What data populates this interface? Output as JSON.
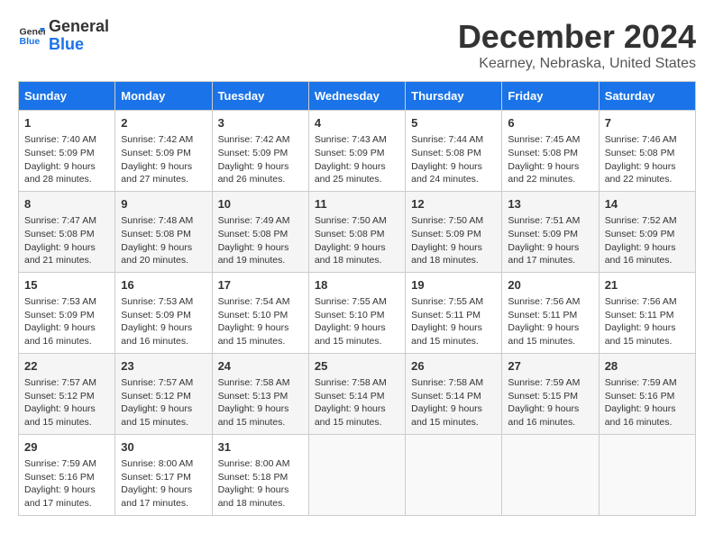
{
  "header": {
    "logo_line1": "General",
    "logo_line2": "Blue",
    "month": "December 2024",
    "location": "Kearney, Nebraska, United States"
  },
  "days_of_week": [
    "Sunday",
    "Monday",
    "Tuesday",
    "Wednesday",
    "Thursday",
    "Friday",
    "Saturday"
  ],
  "weeks": [
    [
      {
        "day": "1",
        "sunrise": "Sunrise: 7:40 AM",
        "sunset": "Sunset: 5:09 PM",
        "daylight": "Daylight: 9 hours and 28 minutes."
      },
      {
        "day": "2",
        "sunrise": "Sunrise: 7:42 AM",
        "sunset": "Sunset: 5:09 PM",
        "daylight": "Daylight: 9 hours and 27 minutes."
      },
      {
        "day": "3",
        "sunrise": "Sunrise: 7:42 AM",
        "sunset": "Sunset: 5:09 PM",
        "daylight": "Daylight: 9 hours and 26 minutes."
      },
      {
        "day": "4",
        "sunrise": "Sunrise: 7:43 AM",
        "sunset": "Sunset: 5:09 PM",
        "daylight": "Daylight: 9 hours and 25 minutes."
      },
      {
        "day": "5",
        "sunrise": "Sunrise: 7:44 AM",
        "sunset": "Sunset: 5:08 PM",
        "daylight": "Daylight: 9 hours and 24 minutes."
      },
      {
        "day": "6",
        "sunrise": "Sunrise: 7:45 AM",
        "sunset": "Sunset: 5:08 PM",
        "daylight": "Daylight: 9 hours and 22 minutes."
      },
      {
        "day": "7",
        "sunrise": "Sunrise: 7:46 AM",
        "sunset": "Sunset: 5:08 PM",
        "daylight": "Daylight: 9 hours and 22 minutes."
      }
    ],
    [
      {
        "day": "8",
        "sunrise": "Sunrise: 7:47 AM",
        "sunset": "Sunset: 5:08 PM",
        "daylight": "Daylight: 9 hours and 21 minutes."
      },
      {
        "day": "9",
        "sunrise": "Sunrise: 7:48 AM",
        "sunset": "Sunset: 5:08 PM",
        "daylight": "Daylight: 9 hours and 20 minutes."
      },
      {
        "day": "10",
        "sunrise": "Sunrise: 7:49 AM",
        "sunset": "Sunset: 5:08 PM",
        "daylight": "Daylight: 9 hours and 19 minutes."
      },
      {
        "day": "11",
        "sunrise": "Sunrise: 7:50 AM",
        "sunset": "Sunset: 5:08 PM",
        "daylight": "Daylight: 9 hours and 18 minutes."
      },
      {
        "day": "12",
        "sunrise": "Sunrise: 7:50 AM",
        "sunset": "Sunset: 5:09 PM",
        "daylight": "Daylight: 9 hours and 18 minutes."
      },
      {
        "day": "13",
        "sunrise": "Sunrise: 7:51 AM",
        "sunset": "Sunset: 5:09 PM",
        "daylight": "Daylight: 9 hours and 17 minutes."
      },
      {
        "day": "14",
        "sunrise": "Sunrise: 7:52 AM",
        "sunset": "Sunset: 5:09 PM",
        "daylight": "Daylight: 9 hours and 16 minutes."
      }
    ],
    [
      {
        "day": "15",
        "sunrise": "Sunrise: 7:53 AM",
        "sunset": "Sunset: 5:09 PM",
        "daylight": "Daylight: 9 hours and 16 minutes."
      },
      {
        "day": "16",
        "sunrise": "Sunrise: 7:53 AM",
        "sunset": "Sunset: 5:09 PM",
        "daylight": "Daylight: 9 hours and 16 minutes."
      },
      {
        "day": "17",
        "sunrise": "Sunrise: 7:54 AM",
        "sunset": "Sunset: 5:10 PM",
        "daylight": "Daylight: 9 hours and 15 minutes."
      },
      {
        "day": "18",
        "sunrise": "Sunrise: 7:55 AM",
        "sunset": "Sunset: 5:10 PM",
        "daylight": "Daylight: 9 hours and 15 minutes."
      },
      {
        "day": "19",
        "sunrise": "Sunrise: 7:55 AM",
        "sunset": "Sunset: 5:11 PM",
        "daylight": "Daylight: 9 hours and 15 minutes."
      },
      {
        "day": "20",
        "sunrise": "Sunrise: 7:56 AM",
        "sunset": "Sunset: 5:11 PM",
        "daylight": "Daylight: 9 hours and 15 minutes."
      },
      {
        "day": "21",
        "sunrise": "Sunrise: 7:56 AM",
        "sunset": "Sunset: 5:11 PM",
        "daylight": "Daylight: 9 hours and 15 minutes."
      }
    ],
    [
      {
        "day": "22",
        "sunrise": "Sunrise: 7:57 AM",
        "sunset": "Sunset: 5:12 PM",
        "daylight": "Daylight: 9 hours and 15 minutes."
      },
      {
        "day": "23",
        "sunrise": "Sunrise: 7:57 AM",
        "sunset": "Sunset: 5:12 PM",
        "daylight": "Daylight: 9 hours and 15 minutes."
      },
      {
        "day": "24",
        "sunrise": "Sunrise: 7:58 AM",
        "sunset": "Sunset: 5:13 PM",
        "daylight": "Daylight: 9 hours and 15 minutes."
      },
      {
        "day": "25",
        "sunrise": "Sunrise: 7:58 AM",
        "sunset": "Sunset: 5:14 PM",
        "daylight": "Daylight: 9 hours and 15 minutes."
      },
      {
        "day": "26",
        "sunrise": "Sunrise: 7:58 AM",
        "sunset": "Sunset: 5:14 PM",
        "daylight": "Daylight: 9 hours and 15 minutes."
      },
      {
        "day": "27",
        "sunrise": "Sunrise: 7:59 AM",
        "sunset": "Sunset: 5:15 PM",
        "daylight": "Daylight: 9 hours and 16 minutes."
      },
      {
        "day": "28",
        "sunrise": "Sunrise: 7:59 AM",
        "sunset": "Sunset: 5:16 PM",
        "daylight": "Daylight: 9 hours and 16 minutes."
      }
    ],
    [
      {
        "day": "29",
        "sunrise": "Sunrise: 7:59 AM",
        "sunset": "Sunset: 5:16 PM",
        "daylight": "Daylight: 9 hours and 17 minutes."
      },
      {
        "day": "30",
        "sunrise": "Sunrise: 8:00 AM",
        "sunset": "Sunset: 5:17 PM",
        "daylight": "Daylight: 9 hours and 17 minutes."
      },
      {
        "day": "31",
        "sunrise": "Sunrise: 8:00 AM",
        "sunset": "Sunset: 5:18 PM",
        "daylight": "Daylight: 9 hours and 18 minutes."
      },
      {
        "day": "",
        "sunrise": "",
        "sunset": "",
        "daylight": ""
      },
      {
        "day": "",
        "sunrise": "",
        "sunset": "",
        "daylight": ""
      },
      {
        "day": "",
        "sunrise": "",
        "sunset": "",
        "daylight": ""
      },
      {
        "day": "",
        "sunrise": "",
        "sunset": "",
        "daylight": ""
      }
    ]
  ]
}
